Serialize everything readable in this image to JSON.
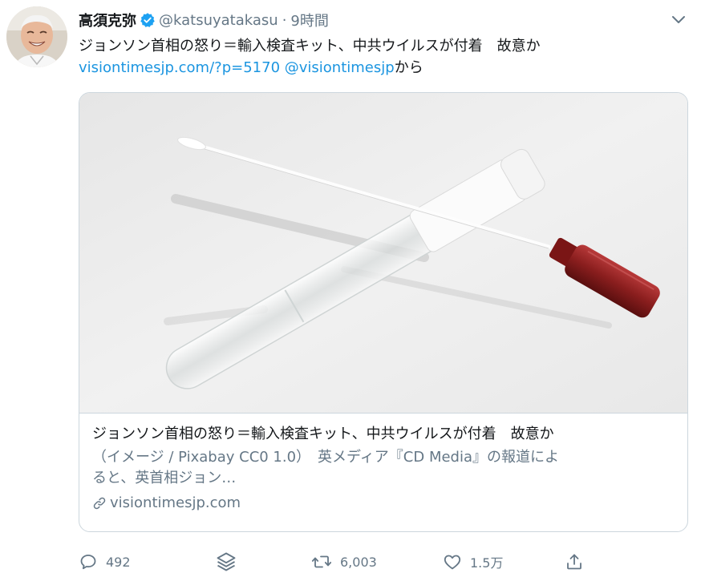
{
  "tweet": {
    "author_name": "高須克弥",
    "handle": "@katsuyatakasu",
    "separator": "·",
    "time": "9時間",
    "text": "ジョンソン首相の怒り＝輸入検査キット、中共ウイルスが付着　故意か",
    "link_url": "visiontimesjp.com/?p=5170",
    "mention": "@visiontimesjp",
    "via_suffix": "から"
  },
  "card": {
    "title": "ジョンソン首相の怒り＝輸入検査キット、中共ウイルスが付着　故意か",
    "description_line1": "（イメージ / Pixabay CC0 1.0）　英メディア『CD Media』の報道によ",
    "description_line2": "ると、英首相ジョン…",
    "domain": "visiontimesjp.com"
  },
  "actions": {
    "reply_count": "492",
    "retweet_count": "6,003",
    "like_count": "1.5万"
  },
  "icons": {
    "verified": "verified-badge-icon",
    "caret": "chevron-down-icon",
    "link": "link-icon",
    "reply": "reply-icon",
    "stack": "stack-icon",
    "retweet": "retweet-icon",
    "like": "heart-icon",
    "share": "share-icon"
  },
  "colors": {
    "link": "#1b95e0",
    "secondary_text": "#657786",
    "verified": "#1da1f2",
    "border": "#ccd6dd"
  }
}
